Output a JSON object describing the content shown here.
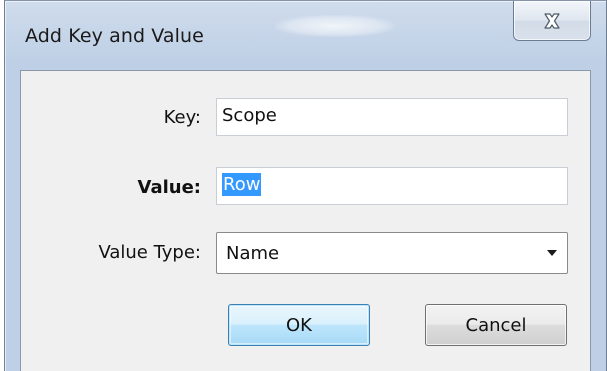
{
  "window": {
    "title": "Add Key and Value",
    "close_icon": "close-icon"
  },
  "form": {
    "key": {
      "label": "Key:",
      "value": "Scope"
    },
    "value": {
      "label": "Value:",
      "value": "Row",
      "text_selected": true
    },
    "value_type": {
      "label": "Value Type:",
      "selected": "Name",
      "dropdown_icon": "chevron-down-icon"
    }
  },
  "buttons": {
    "ok_label": "OK",
    "cancel_label": "Cancel"
  },
  "colors": {
    "selection_highlight": "#3399ff",
    "default_button_border": "#3c7fb1",
    "frame": "#bfd0e6",
    "client_background": "#f0f0f0"
  }
}
